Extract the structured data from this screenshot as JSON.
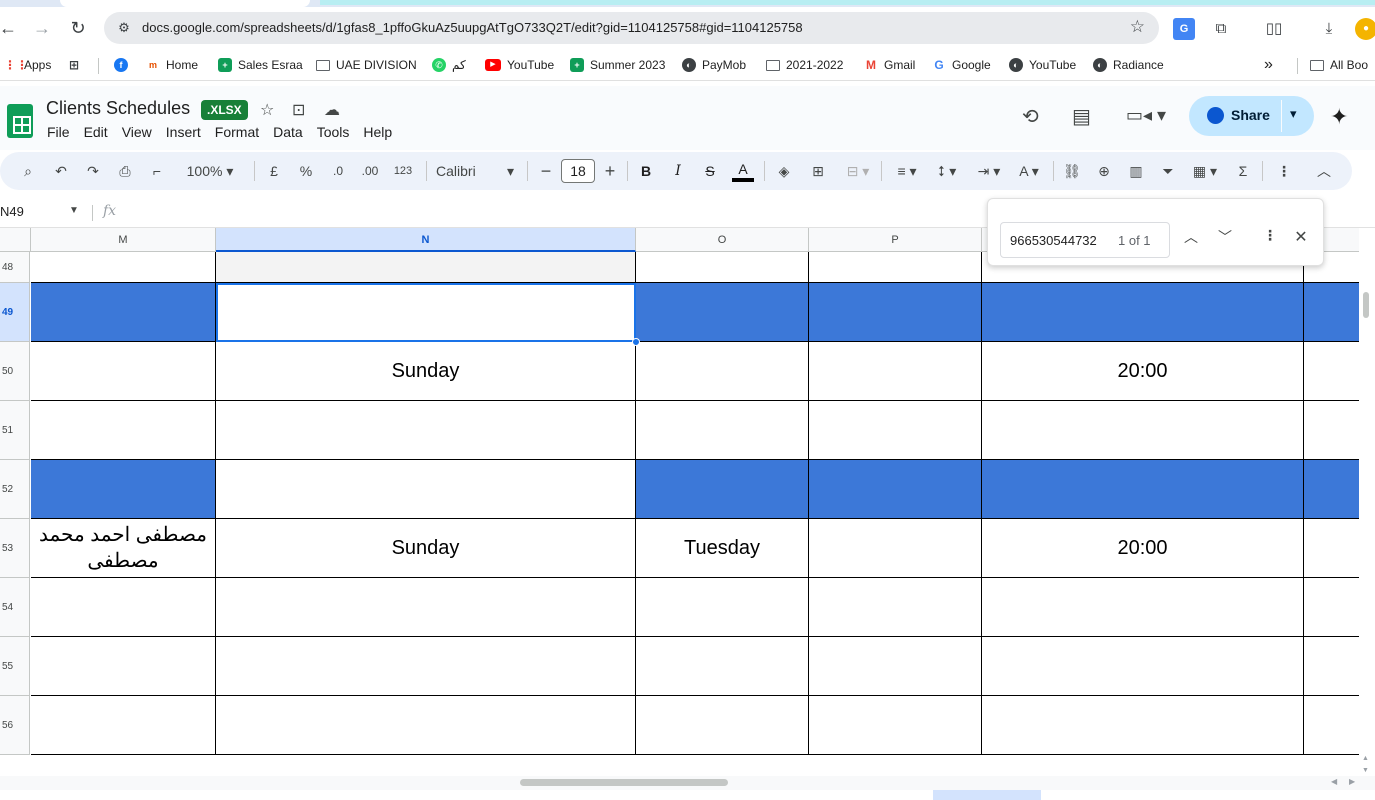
{
  "browser": {
    "url": "docs.google.com/spreadsheets/d/1gfas8_1pffoGkuAz5uupgAtTgO733Q2T/edit?gid=1104125758#gid=1104125758",
    "bookmarks": [
      {
        "label": "Apps"
      },
      {
        "label": ""
      },
      {
        "label": ""
      },
      {
        "label": "Home"
      },
      {
        "label": "Sales Esraa"
      },
      {
        "label": "UAE DIVISION"
      },
      {
        "label": "كم"
      },
      {
        "label": "YouTube"
      },
      {
        "label": "Summer 2023"
      },
      {
        "label": "PayMob"
      },
      {
        "label": "2021-2022"
      },
      {
        "label": "Gmail"
      },
      {
        "label": "Google"
      },
      {
        "label": "YouTube"
      },
      {
        "label": "Radiance"
      }
    ],
    "more_label": "»",
    "all_bookmarks": "All Boo"
  },
  "doc": {
    "title": "Clients Schedules",
    "badge": ".XLSX",
    "menu": [
      "File",
      "Edit",
      "View",
      "Insert",
      "Format",
      "Data",
      "Tools",
      "Help"
    ],
    "share_label": "Share"
  },
  "toolbar": {
    "zoom": "100%",
    "currency": "£",
    "percent": "%",
    "dec_decrease": ".0",
    "dec_increase": ".00",
    "format_123": "123",
    "font": "Calibri",
    "font_size": "18",
    "minus": "−",
    "plus": "+",
    "bold": "B",
    "italic": "I",
    "strike": "S",
    "text_color": "A",
    "sigma": "Σ"
  },
  "formula_bar": {
    "name_box": "N49",
    "fx": "fx"
  },
  "find": {
    "query": "966530544732",
    "count": "1 of 1"
  },
  "grid": {
    "columns": [
      {
        "label": "M"
      },
      {
        "label": "N",
        "selected": true
      },
      {
        "label": "O"
      },
      {
        "label": "P"
      },
      {
        "label": ""
      }
    ],
    "rows": [
      {
        "num": "48",
        "cells": [
          "",
          "",
          "",
          "",
          "",
          ""
        ]
      },
      {
        "num": "49",
        "selected": true,
        "cells": [
          "",
          "",
          "",
          "",
          "",
          ""
        ]
      },
      {
        "num": "50",
        "cells": [
          "",
          "Sunday",
          "",
          "",
          "20:00",
          ""
        ]
      },
      {
        "num": "51",
        "cells": [
          "",
          "",
          "",
          "",
          "",
          ""
        ]
      },
      {
        "num": "52",
        "cells": [
          "",
          "",
          "",
          "",
          "",
          ""
        ]
      },
      {
        "num": "53",
        "cells": [
          "مصطفى احمد محمد مصطفى",
          "Sunday",
          "Tuesday",
          "",
          "20:00",
          ""
        ]
      },
      {
        "num": "54",
        "cells": [
          "",
          "",
          "",
          "",
          "",
          ""
        ]
      },
      {
        "num": "55",
        "cells": [
          "",
          "",
          "",
          "",
          "",
          ""
        ]
      },
      {
        "num": "56",
        "cells": [
          "",
          "",
          "",
          "",
          "",
          ""
        ]
      }
    ],
    "highlight_color": "#3c78d8"
  }
}
